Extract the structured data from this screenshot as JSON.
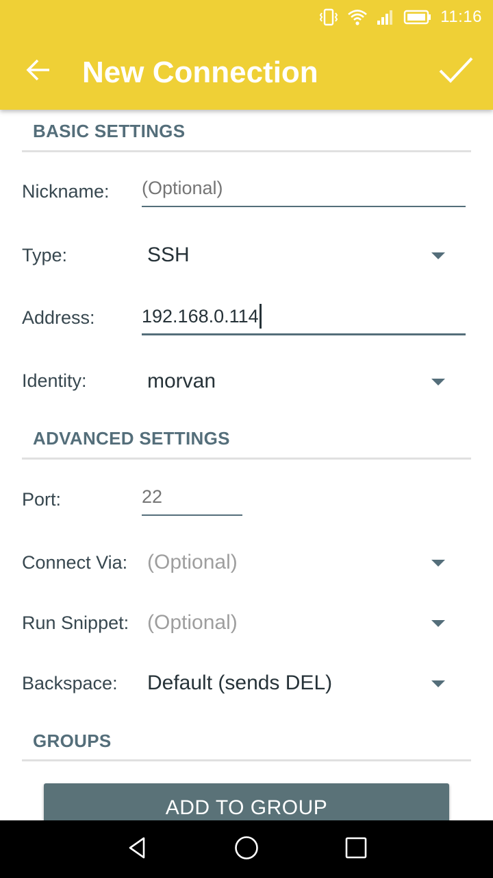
{
  "status_bar": {
    "time": "11:16",
    "icons": [
      "vibrate-icon",
      "wifi-icon",
      "signal-icon",
      "battery-icon"
    ]
  },
  "toolbar": {
    "title": "New Connection",
    "back_icon": "arrow-back-icon",
    "save_icon": "check-icon"
  },
  "colors": {
    "accent": "#EFD036",
    "section_text": "#546E7A",
    "button_bg": "#5A7278"
  },
  "sections": {
    "basic": "BASIC SETTINGS",
    "advanced": "ADVANCED SETTINGS",
    "groups": "GROUPS"
  },
  "fields": {
    "nickname": {
      "label": "Nickname:",
      "value": "",
      "placeholder": "(Optional)"
    },
    "type": {
      "label": "Type:",
      "selected": "SSH"
    },
    "address": {
      "label": "Address:",
      "value": "192.168.0.114"
    },
    "identity": {
      "label": "Identity:",
      "selected": "morvan"
    },
    "port": {
      "label": "Port:",
      "value": "",
      "placeholder": "22"
    },
    "connect_via": {
      "label": "Connect Via:",
      "selected": "",
      "placeholder": "(Optional)"
    },
    "run_snippet": {
      "label": "Run Snippet:",
      "selected": "",
      "placeholder": "(Optional)"
    },
    "backspace": {
      "label": "Backspace:",
      "selected": "Default (sends DEL)"
    }
  },
  "buttons": {
    "add_to_group": "ADD TO GROUP"
  },
  "nav_bar": {
    "icons": [
      "back-triangle-icon",
      "home-circle-icon",
      "recents-square-icon"
    ]
  }
}
